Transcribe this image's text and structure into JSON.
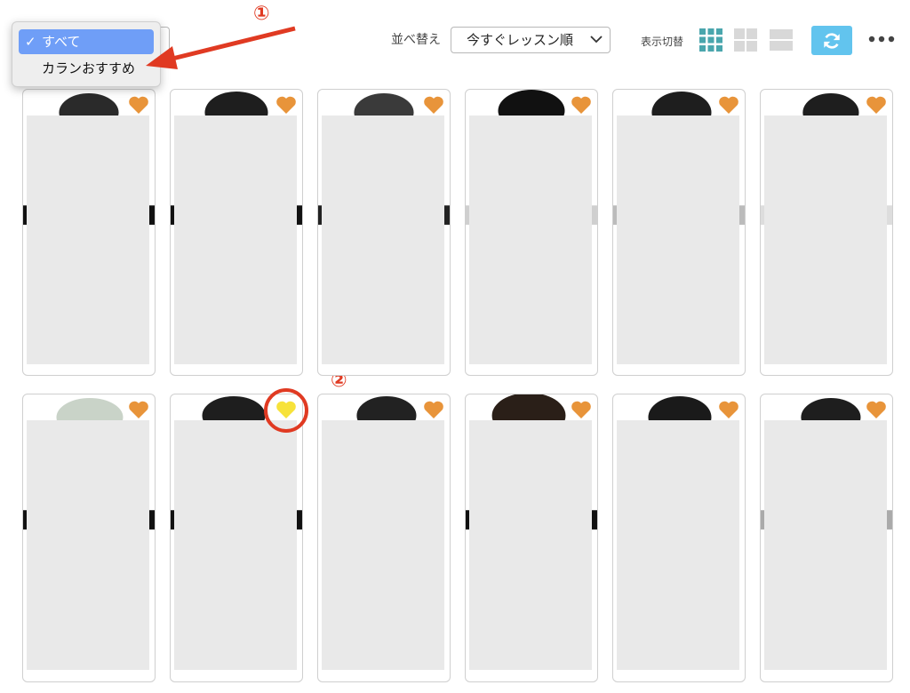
{
  "filter": {
    "options": [
      {
        "label": "すべて",
        "selected": true
      },
      {
        "label": "カランおすすめ",
        "selected": false
      }
    ]
  },
  "sort": {
    "label": "並べ替え",
    "selected": "今すぐレッスン順"
  },
  "view": {
    "label": "表示切替",
    "modes": [
      "grid-small",
      "grid-large",
      "list"
    ],
    "active_mode": "grid-small"
  },
  "annotations": {
    "marker_1": "①",
    "marker_2": "②"
  },
  "colors": {
    "accent_blue": "#62c4ee",
    "heart_orange": "#e8943a",
    "heart_favorited": "#f7e23a",
    "annotation_red": "#e03a22",
    "dropdown_highlight": "#6f9ef7"
  },
  "tutors": [
    {
      "row": 1,
      "col": 1,
      "favorited": false
    },
    {
      "row": 1,
      "col": 2,
      "favorited": false
    },
    {
      "row": 1,
      "col": 3,
      "favorited": false
    },
    {
      "row": 1,
      "col": 4,
      "favorited": false
    },
    {
      "row": 1,
      "col": 5,
      "favorited": false
    },
    {
      "row": 1,
      "col": 6,
      "favorited": false
    },
    {
      "row": 2,
      "col": 1,
      "favorited": false
    },
    {
      "row": 2,
      "col": 2,
      "favorited": true
    },
    {
      "row": 2,
      "col": 3,
      "favorited": false
    },
    {
      "row": 2,
      "col": 4,
      "favorited": false
    },
    {
      "row": 2,
      "col": 5,
      "favorited": false
    },
    {
      "row": 2,
      "col": 6,
      "favorited": false
    }
  ]
}
